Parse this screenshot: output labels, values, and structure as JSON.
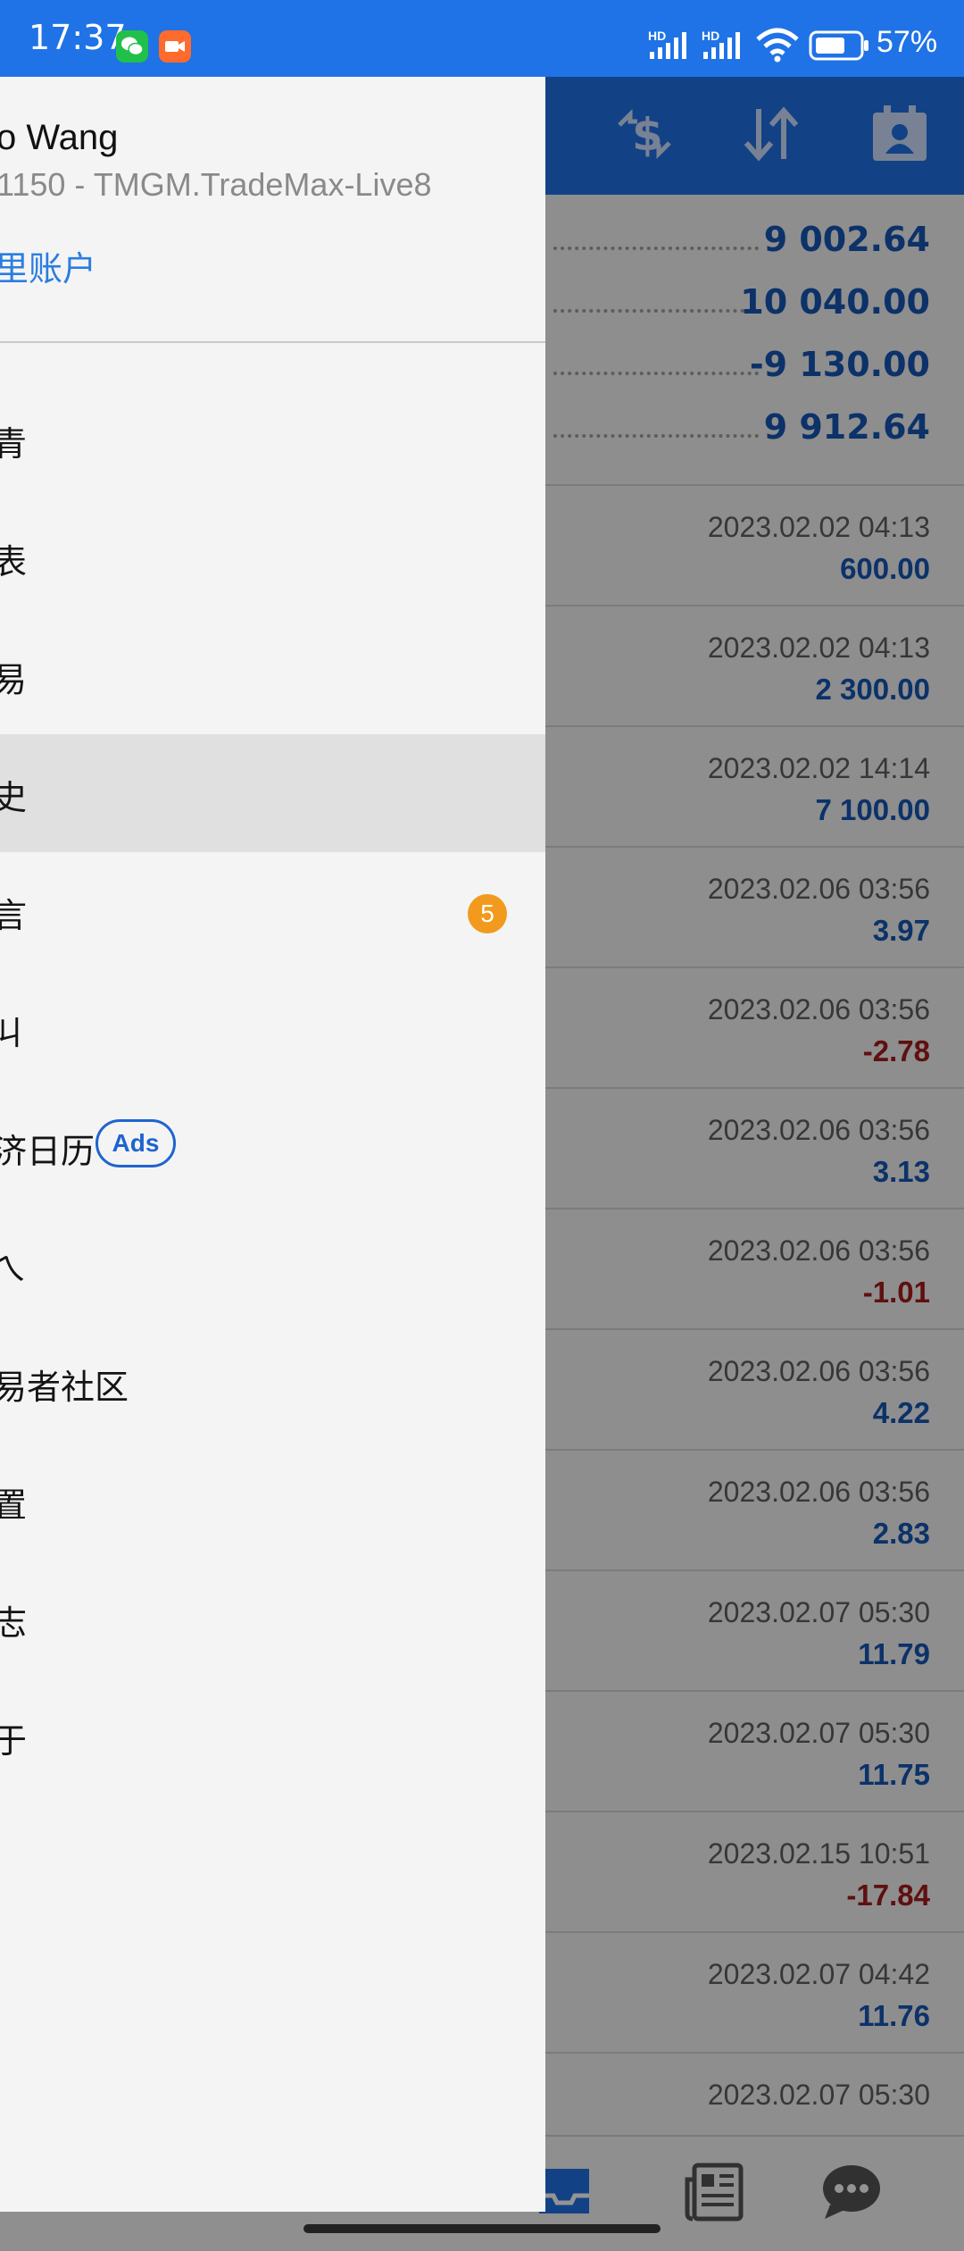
{
  "status_bar": {
    "time": "17:37",
    "battery_percent": "57%",
    "network_label_1": "HD",
    "network_label_2": "HD"
  },
  "toolbar": {
    "icons": [
      "currency-exchange-icon",
      "sort-icon",
      "contact-card-icon"
    ]
  },
  "summary": [
    {
      "value": "9 002.64"
    },
    {
      "value": "10 040.00"
    },
    {
      "value": "-9 130.00"
    },
    {
      "value": "9 912.64"
    }
  ],
  "trades": [
    {
      "date": "2023.02.02 04:13",
      "amount": "600.00",
      "positive": true
    },
    {
      "date": "2023.02.02 04:13",
      "amount": "2 300.00",
      "positive": true
    },
    {
      "date": "2023.02.02 14:14",
      "amount": "7 100.00",
      "positive": true
    },
    {
      "date": "2023.02.06 03:56",
      "amount": "3.97",
      "positive": true
    },
    {
      "date": "2023.02.06 03:56",
      "amount": "-2.78",
      "positive": false
    },
    {
      "date": "2023.02.06 03:56",
      "amount": "3.13",
      "positive": true
    },
    {
      "date": "2023.02.06 03:56",
      "amount": "-1.01",
      "positive": false
    },
    {
      "date": "2023.02.06 03:56",
      "amount": "4.22",
      "positive": true
    },
    {
      "date": "2023.02.06 03:56",
      "amount": "2.83",
      "positive": true
    },
    {
      "date": "2023.02.07 05:30",
      "amount": "11.79",
      "positive": true
    },
    {
      "date": "2023.02.07 05:30",
      "amount": "11.75",
      "positive": true
    },
    {
      "date": "2023.02.15 10:51",
      "amount": "-17.84",
      "positive": false
    },
    {
      "date": "2023.02.07 04:42",
      "amount": "11.76",
      "positive": true
    },
    {
      "date": "2023.02.07 05:30",
      "amount": "",
      "positive": true
    }
  ],
  "bottom_nav": {
    "icons": [
      "inbox-icon",
      "news-icon",
      "chat-icon"
    ]
  },
  "drawer": {
    "user_name": "o Wang",
    "account": "1150 - TMGM.TradeMax-Live8",
    "manage_accounts": "里账户",
    "items": [
      {
        "label": "青"
      },
      {
        "label": "表"
      },
      {
        "label": "易"
      },
      {
        "label": "史"
      },
      {
        "label": "言",
        "badge": "5"
      },
      {
        "label": "ㄐ"
      },
      {
        "label": "济日历",
        "chip": "Ads"
      },
      {
        "label": "ㄟ"
      },
      {
        "label": "易者社区"
      },
      {
        "label": "置"
      },
      {
        "label": "志"
      },
      {
        "label": "于"
      }
    ]
  },
  "colors": {
    "primary": "#1f73e6",
    "value_blue": "#1656b6",
    "value_red": "#a41c1c",
    "badge_orange": "#f29a1d"
  }
}
